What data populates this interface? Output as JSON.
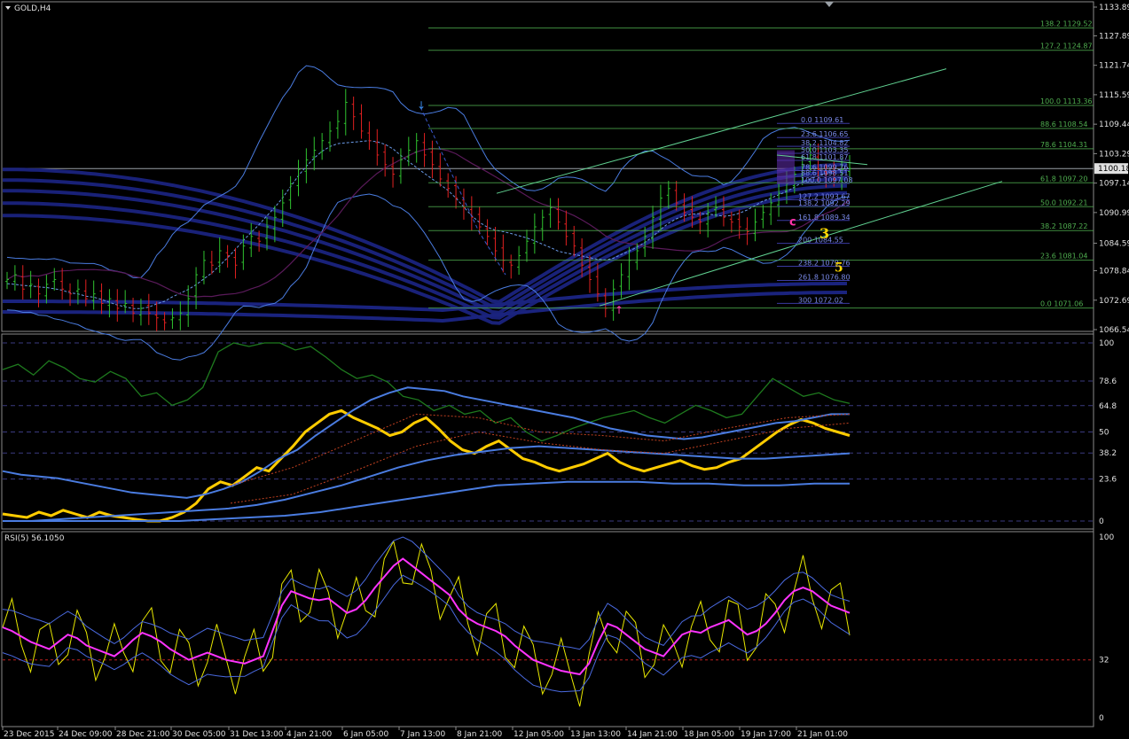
{
  "symbol": "GOLD,H4",
  "rsi_label": "RSI(5) 56.1050",
  "current_price": "1100.18",
  "price_axis": [
    "1133.89",
    "1127.89",
    "1121.74",
    "1115.59",
    "1109.44",
    "1103.29",
    "1097.14",
    "1090.99",
    "1084.59",
    "1078.84",
    "1072.69",
    "1066.54"
  ],
  "stoch_axis": [
    "100",
    "78.6",
    "64.8",
    "50",
    "38.2",
    "23.6",
    "0"
  ],
  "rsi_axis": [
    "100",
    "32",
    "0"
  ],
  "time_axis": [
    "23 Dec 2015",
    "24 Dec 09:00",
    "28 Dec 21:00",
    "30 Dec 05:00",
    "31 Dec 13:00",
    "4 Jan 21:00",
    "6 Jan 05:00",
    "7 Jan 13:00",
    "8 Jan 21:00",
    "12 Jan 05:00",
    "13 Jan 13:00",
    "14 Jan 21:00",
    "18 Jan 05:00",
    "19 Jan 17:00",
    "21 Jan 01:00"
  ],
  "fib_main": [
    {
      "label": "138.2 1129.52",
      "color": "#4fae4f"
    },
    {
      "label": "127.2 1124.87",
      "color": "#4fae4f"
    },
    {
      "label": "100.0 1113.36",
      "color": "#4fae4f"
    },
    {
      "label": "88.6 1108.54",
      "color": "#4fae4f"
    },
    {
      "label": "78.6 1104.31",
      "color": "#4fae4f"
    },
    {
      "label": "61.8 1097.20",
      "color": "#4fae4f"
    },
    {
      "label": "50.0 1092.21",
      "color": "#4fae4f"
    },
    {
      "label": "38.2 1087.22",
      "color": "#4fae4f"
    },
    {
      "label": "23.6 1081.04",
      "color": "#4fae4f"
    },
    {
      "label": "0.0 1071.06",
      "color": "#4fae4f"
    }
  ],
  "fib_small": [
    {
      "label": "0.0 1109.61"
    },
    {
      "label": "23.6 1106.65"
    },
    {
      "label": "38.2 1104.82"
    },
    {
      "label": "50.0 1103.35"
    },
    {
      "label": "61.8 1101.87"
    },
    {
      "label": "78.6 1099.76"
    },
    {
      "label": "88.6 1098.51"
    },
    {
      "label": "100.0 1097.08"
    },
    {
      "label": "127.2 1093.67"
    },
    {
      "label": "138.2 1092.29"
    },
    {
      "label": "161.8 1089.34"
    },
    {
      "label": "200 1084.55"
    },
    {
      "label": "238.2 1079.76"
    },
    {
      "label": "261.8 1076.80"
    },
    {
      "label": "300 1072.02"
    }
  ],
  "wave_labels": {
    "c": "c",
    "w3": "3",
    "w5": "5"
  },
  "colors": {
    "bull": "#2fc22f",
    "bear": "#e02020",
    "ma": "#1a237e",
    "band": "#4a7ce0",
    "fib": "#4fae4f",
    "stoch_green": "#1e7a1e",
    "stoch_yellow": "#ffcc00",
    "rsi_magenta": "#ff33ff",
    "rsi_yellow": "#e8e800"
  },
  "chart_data": [
    {
      "type": "candlestick",
      "title": "GOLD,H4",
      "ylim": [
        1066.54,
        1133.89
      ],
      "close_profile": [
        1077,
        1078,
        1075,
        1076,
        1074,
        1076,
        1077,
        1075,
        1074,
        1075,
        1073,
        1074,
        1072,
        1073,
        1071,
        1072,
        1070,
        1071,
        1070,
        1069,
        1068,
        1069,
        1070,
        1073,
        1078,
        1081,
        1080,
        1083,
        1082,
        1080,
        1084,
        1086,
        1085,
        1088,
        1090,
        1093,
        1097,
        1100,
        1102,
        1104,
        1106,
        1108,
        1110,
        1114,
        1111,
        1108,
        1106,
        1103,
        1101,
        1099,
        1102,
        1104,
        1106,
        1103,
        1101,
        1098,
        1096,
        1094,
        1092,
        1090,
        1088,
        1086,
        1083,
        1081,
        1080,
        1082,
        1085,
        1088,
        1090,
        1092,
        1089,
        1086,
        1084,
        1080,
        1077,
        1074,
        1071,
        1075,
        1078,
        1081,
        1083,
        1086,
        1090,
        1094,
        1096,
        1093,
        1091,
        1090,
        1089,
        1091,
        1092,
        1090,
        1089,
        1088,
        1087,
        1089,
        1091,
        1093,
        1095,
        1097,
        1099,
        1101,
        1103,
        1100,
        1099,
        1098,
        1100,
        1100.18
      ]
    },
    {
      "type": "line",
      "title": "",
      "ylim": [
        0,
        100
      ],
      "series": [
        {
          "name": "",
          "color": "#ffcc00",
          "values": [
            4,
            3,
            2,
            5,
            3,
            6,
            4,
            2,
            5,
            3,
            2,
            1,
            0,
            0,
            2,
            5,
            10,
            18,
            22,
            20,
            25,
            30,
            28,
            35,
            42,
            50,
            55,
            60,
            62,
            58,
            55,
            52,
            48,
            50,
            55,
            58,
            52,
            45,
            40,
            38,
            42,
            45,
            40,
            35,
            33,
            30,
            28,
            30,
            32,
            35,
            38,
            33,
            30,
            28,
            30,
            32,
            34,
            31,
            29,
            30,
            33,
            35,
            40,
            45,
            50,
            54,
            57,
            55,
            52,
            50,
            48
          ]
        },
        {
          "name": "",
          "color": "#1e7a1e",
          "values": [
            85,
            88,
            82,
            90,
            86,
            80,
            78,
            84,
            80,
            70,
            72,
            65,
            68,
            75,
            95,
            100,
            98,
            100,
            100,
            96,
            98,
            92,
            85,
            80,
            82,
            78,
            70,
            68,
            62,
            65,
            60,
            62,
            55,
            58,
            50,
            45,
            48,
            52,
            55,
            58,
            60,
            62,
            58,
            55,
            60,
            65,
            62,
            58,
            60,
            70,
            80,
            75,
            70,
            72,
            68,
            66
          ]
        },
        {
          "name": "",
          "color": "#4a7ce0",
          "values": [
            28,
            26,
            25,
            24,
            22,
            20,
            18,
            16,
            15,
            14,
            13,
            15,
            18,
            22,
            28,
            35,
            40,
            48,
            55,
            62,
            68,
            72,
            75,
            74,
            73,
            70,
            68,
            66,
            64,
            62,
            60,
            58,
            55,
            52,
            50,
            48,
            47,
            46,
            47,
            49,
            51,
            53,
            55,
            56,
            58,
            60,
            60
          ]
        },
        {
          "name": "",
          "color": "#4a7ce0",
          "values": [
            0,
            0,
            1,
            2,
            3,
            4,
            5,
            6,
            7,
            9,
            12,
            16,
            20,
            25,
            30,
            34,
            37,
            39,
            41,
            42,
            41,
            40,
            39,
            38,
            37,
            36,
            35,
            35,
            36,
            37,
            38
          ]
        },
        {
          "name": "",
          "color": "#4a7ce0",
          "values": [
            0,
            0,
            0,
            0,
            0,
            0,
            1,
            2,
            3,
            5,
            8,
            11,
            14,
            17,
            20,
            21,
            22,
            22,
            22,
            21,
            21,
            20,
            20,
            21,
            21
          ]
        }
      ]
    },
    {
      "type": "line",
      "title": "RSI(5) 56.1050",
      "ylim": [
        0,
        100
      ],
      "series": [
        {
          "name": "",
          "color": "#ff33ff",
          "values": [
            50,
            48,
            45,
            42,
            40,
            38,
            42,
            46,
            44,
            40,
            38,
            36,
            34,
            38,
            43,
            47,
            45,
            42,
            38,
            35,
            32,
            34,
            36,
            34,
            32,
            31,
            30,
            32,
            34,
            48,
            62,
            70,
            68,
            66,
            65,
            66,
            62,
            58,
            60,
            65,
            72,
            78,
            84,
            88,
            84,
            80,
            76,
            72,
            68,
            60,
            55,
            52,
            50,
            48,
            45,
            40,
            36,
            32,
            30,
            28,
            26,
            25,
            24,
            30,
            42,
            52,
            50,
            46,
            42,
            38,
            36,
            34,
            40,
            46,
            48,
            47,
            50,
            52,
            54,
            50,
            46,
            48,
            52,
            58,
            65,
            70,
            72,
            70,
            66,
            62,
            60,
            58
          ]
        }
      ]
    }
  ]
}
